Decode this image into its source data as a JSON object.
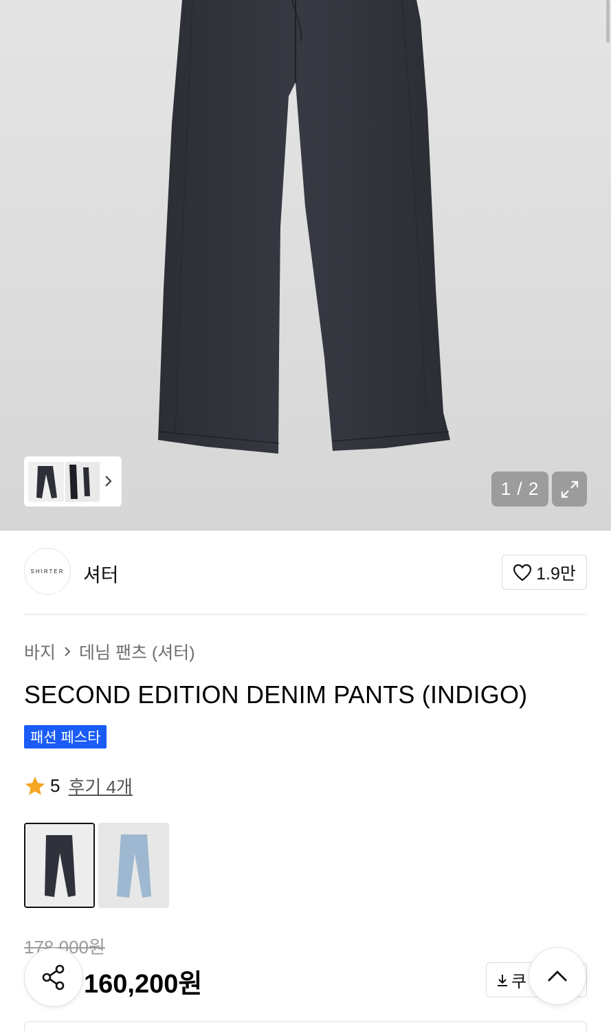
{
  "gallery": {
    "counter": "1 / 2",
    "current_index": 1,
    "total": 2
  },
  "brand": {
    "logo_text": "SHIRTER",
    "name": "셔터",
    "like_count": "1.9만"
  },
  "breadcrumb": {
    "category": "바지",
    "subcategory": "데님 팬츠 (셔터)"
  },
  "product": {
    "title": "SECOND EDITION DENIM PANTS (INDIGO)",
    "badge": "패션 페스타"
  },
  "rating": {
    "score": "5",
    "reviews_label": "후기 4개"
  },
  "price": {
    "original": "178,000원",
    "sale": "160,200원"
  },
  "coupon": {
    "label": "쿠"
  },
  "colors": {
    "star": "#f5a623",
    "badge": "#1a5cf5",
    "denim_dark": "#2f323a",
    "denim_light": "#9db8d0"
  }
}
